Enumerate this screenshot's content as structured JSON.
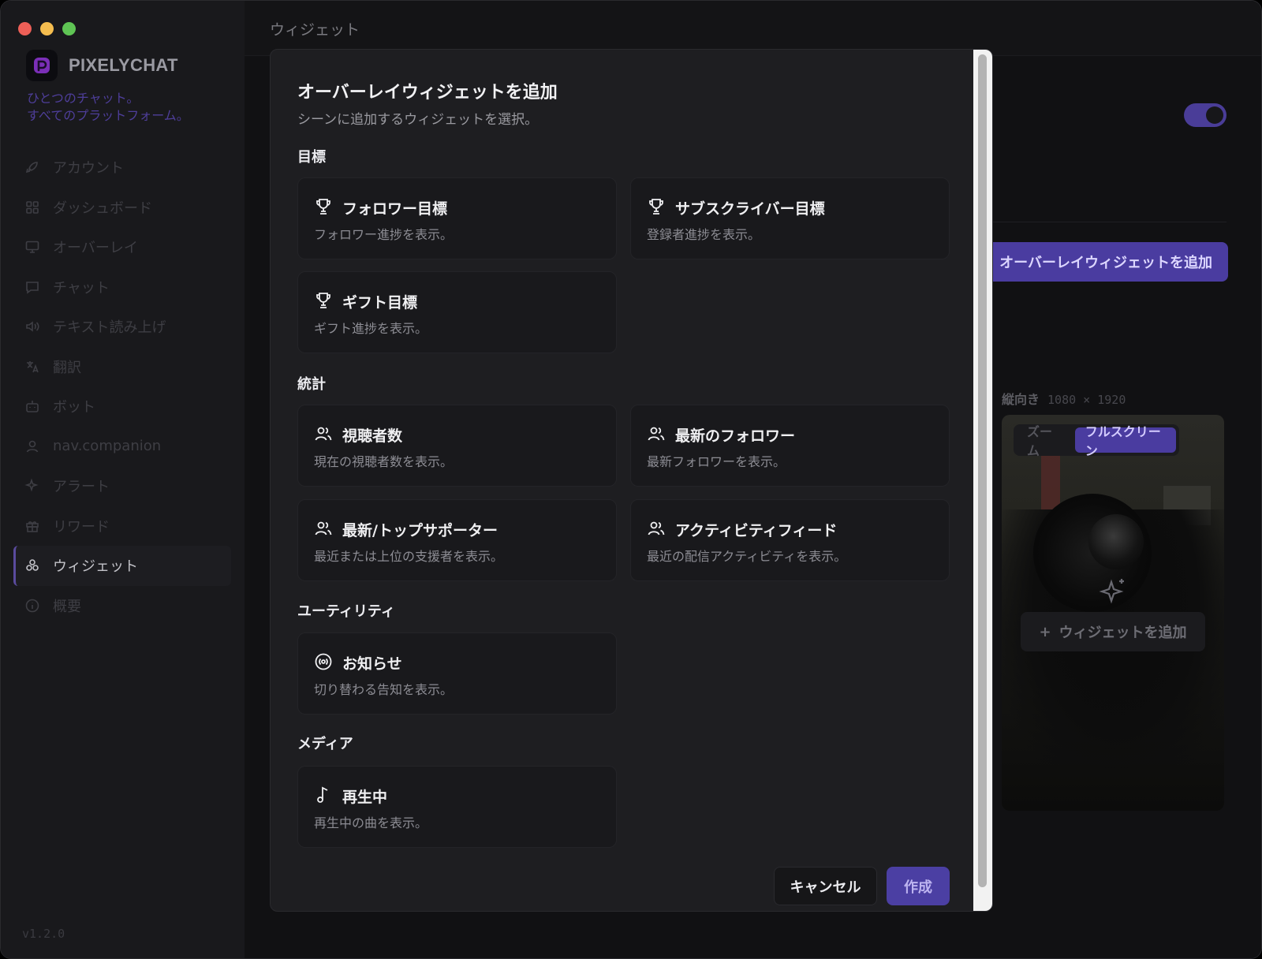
{
  "window": {
    "page_title": "ウィジェット"
  },
  "sidebar": {
    "brand": "PIXELYCHAT",
    "tagline_1": "ひとつのチャット。",
    "tagline_2": "すべてのプラットフォーム。",
    "items": [
      {
        "label": "アカウント",
        "icon": "rocket-icon"
      },
      {
        "label": "ダッシュボード",
        "icon": "grid-icon"
      },
      {
        "label": "オーバーレイ",
        "icon": "monitor-icon"
      },
      {
        "label": "チャット",
        "icon": "chat-icon"
      },
      {
        "label": "テキスト読み上げ",
        "icon": "speaker-icon"
      },
      {
        "label": "翻訳",
        "icon": "translate-icon"
      },
      {
        "label": "ボット",
        "icon": "bot-icon"
      },
      {
        "label": "nav.companion",
        "icon": "user-icon"
      },
      {
        "label": "アラート",
        "icon": "sparkle-icon"
      },
      {
        "label": "リワード",
        "icon": "gift-icon"
      },
      {
        "label": "ウィジェット",
        "icon": "widgets-icon",
        "active": true
      },
      {
        "label": "概要",
        "icon": "info-icon"
      }
    ],
    "version": "v1.2.0"
  },
  "background": {
    "add_overlay_widget": "オーバーレイウィジェットを追加",
    "orientation": "縦向き",
    "dimensions": "1080 × 1920",
    "zoom": "ズーム",
    "fullscreen": "フルスクリーン",
    "add_widget": "ウィジェットを追加"
  },
  "modal": {
    "title": "オーバーレイウィジェットを追加",
    "subtitle": "シーンに追加するウィジェットを選択。",
    "sections": {
      "goals": "目標",
      "stats": "統計",
      "utility": "ユーティリティ",
      "media": "メディア"
    },
    "cards": {
      "follower_goal": {
        "title": "フォロワー目標",
        "desc": "フォロワー進捗を表示。",
        "icon": "trophy-icon"
      },
      "sub_goal": {
        "title": "サブスクライバー目標",
        "desc": "登録者進捗を表示。",
        "icon": "trophy-icon"
      },
      "gift_goal": {
        "title": "ギフト目標",
        "desc": "ギフト進捗を表示。",
        "icon": "trophy-icon"
      },
      "viewers": {
        "title": "視聴者数",
        "desc": "現在の視聴者数を表示。",
        "icon": "users-icon"
      },
      "latest_follower": {
        "title": "最新のフォロワー",
        "desc": "最新フォロワーを表示。",
        "icon": "users-icon"
      },
      "top_supporter": {
        "title": "最新/トップサポーター",
        "desc": "最近または上位の支援者を表示。",
        "icon": "users-icon"
      },
      "activity_feed": {
        "title": "アクティビティフィード",
        "desc": "最近の配信アクティビティを表示。",
        "icon": "users-icon"
      },
      "announcements": {
        "title": "お知らせ",
        "desc": "切り替わる告知を表示。",
        "icon": "broadcast-icon"
      },
      "now_playing": {
        "title": "再生中",
        "desc": "再生中の曲を表示。",
        "icon": "music-note-icon"
      }
    },
    "cancel": "キャンセル",
    "create": "作成"
  }
}
